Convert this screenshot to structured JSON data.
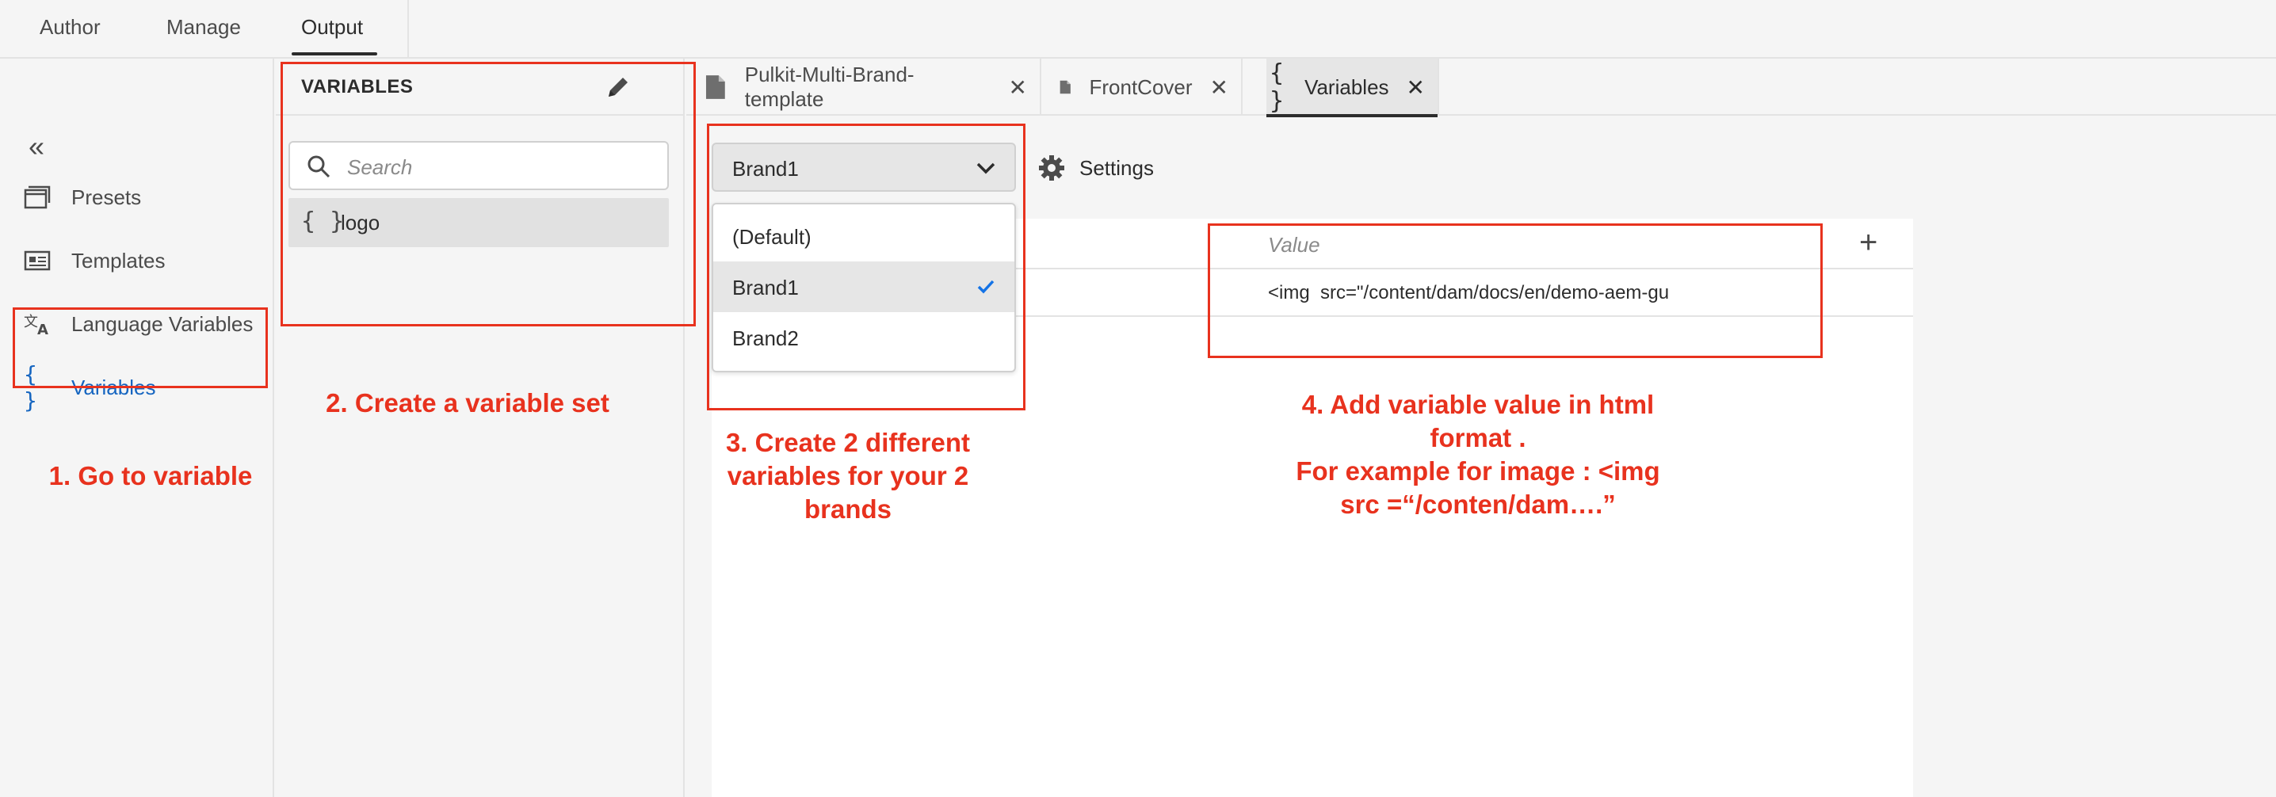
{
  "topnav": {
    "tabs": [
      {
        "label": "Author"
      },
      {
        "label": "Manage"
      },
      {
        "label": "Output"
      }
    ]
  },
  "sidebar": {
    "items": [
      {
        "label": "Presets",
        "icon": "presets-icon"
      },
      {
        "label": "Templates",
        "icon": "templates-icon"
      },
      {
        "label": "Language Variables",
        "icon": "language-icon"
      },
      {
        "label": "Variables",
        "icon": "braces-icon",
        "active": true
      }
    ]
  },
  "variables_panel": {
    "title": "VARIABLES",
    "search_placeholder": "Search",
    "items": [
      {
        "label": "logo"
      }
    ]
  },
  "editor_tabs": [
    {
      "label": "Pulkit-Multi-Brand-template",
      "icon": "file-icon"
    },
    {
      "label": "FrontCover",
      "icon": "file-icon"
    },
    {
      "label": "Variables",
      "icon": "braces-icon",
      "active": true
    }
  ],
  "main": {
    "brand_select": {
      "value": "Brand1"
    },
    "settings_label": "Settings",
    "dropdown_options": [
      {
        "label": "(Default)"
      },
      {
        "label": "Brand1",
        "selected": true
      },
      {
        "label": "Brand2"
      }
    ],
    "table": {
      "value_header": "Value",
      "rows": [
        {
          "value": "<img  src=\"/content/dam/docs/en/demo-aem-gu"
        }
      ]
    }
  },
  "annotations": {
    "step1": "1. Go to variable",
    "step2": "2. Create a variable set",
    "step3": [
      "3. Create  2 different",
      "variables for your 2",
      "brands"
    ],
    "step4": [
      "4. Add variable value in html",
      "format .",
      "For example for image : <img",
      "src =“/conten/dam….”"
    ]
  },
  "colors": {
    "annotation_red": "#e8321e",
    "active_blue": "#1565c0",
    "checkmark_blue": "#1473e6"
  }
}
